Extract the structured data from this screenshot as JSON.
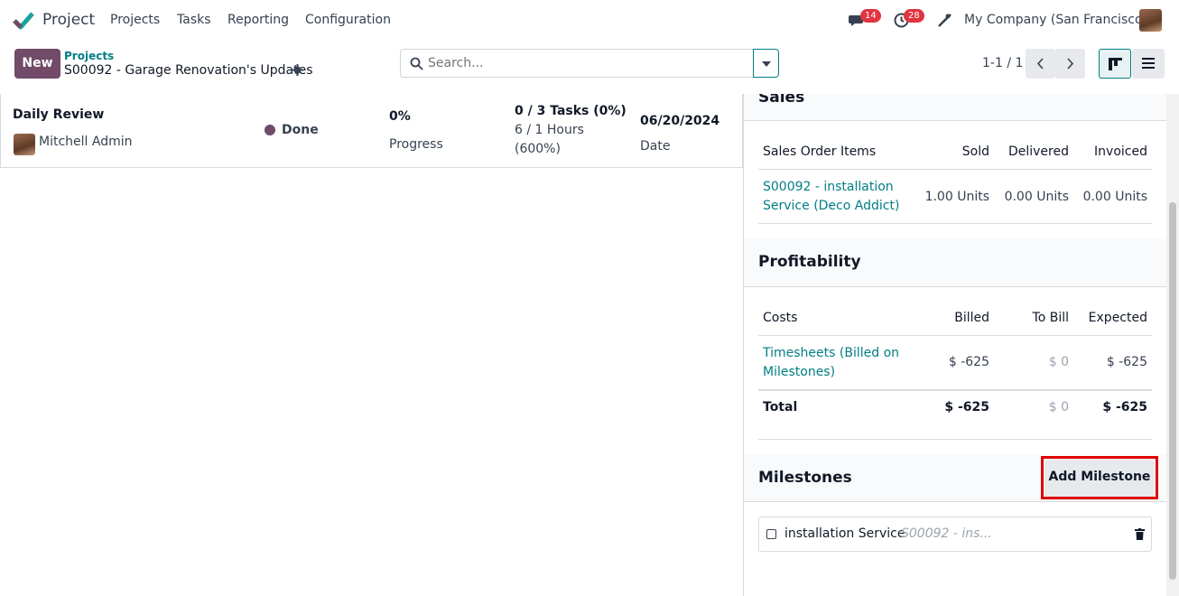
{
  "topbar": {
    "app_name": "Project",
    "menu": [
      "Projects",
      "Tasks",
      "Reporting",
      "Configuration"
    ],
    "messages_count": "14",
    "activities_count": "28",
    "company": "My Company (San Francisco)"
  },
  "control": {
    "new_label": "New",
    "breadcrumb_parent": "Projects",
    "breadcrumb_current": "S00092 - Garage Renovation's Updates",
    "search_placeholder": "Search...",
    "pager": "1-1 / 1"
  },
  "update_card": {
    "name": "Daily Review",
    "author": "Mitchell Admin",
    "status": "Done",
    "status_color": "#714b67",
    "progress_value": "0%",
    "progress_label": "Progress",
    "tasks": "0 / 3 Tasks (0%)",
    "hours_line1": "6 / 1 Hours",
    "hours_line2": "(600%)",
    "date_value": "06/20/2024",
    "date_label": "Date"
  },
  "sales": {
    "title": "Sales",
    "headers": [
      "Sales Order Items",
      "Sold",
      "Delivered",
      "Invoiced"
    ],
    "row": {
      "item_line1": "S00092 - installation",
      "item_line2": "Service (Deco Addict)",
      "sold": "1.00 Units",
      "delivered": "0.00 Units",
      "invoiced": "0.00 Units"
    }
  },
  "profitability": {
    "title": "Profitability",
    "headers": [
      "Costs",
      "Billed",
      "To Bill",
      "Expected"
    ],
    "row": {
      "label_line1": "Timesheets (Billed on",
      "label_line2": "Milestones)",
      "billed": "$ -625",
      "to_bill": "$ 0",
      "expected": "$ -625"
    },
    "total": {
      "label": "Total",
      "billed": "$ -625",
      "to_bill": "$ 0",
      "expected": "$ -625"
    }
  },
  "milestones": {
    "title": "Milestones",
    "add_label": "Add Milestone",
    "items": [
      {
        "name": "installation Service",
        "ref": "S00092 - ins..."
      }
    ]
  },
  "colors": {
    "brand": "#714b67",
    "link": "#017e84",
    "highlight": "#e00000"
  }
}
